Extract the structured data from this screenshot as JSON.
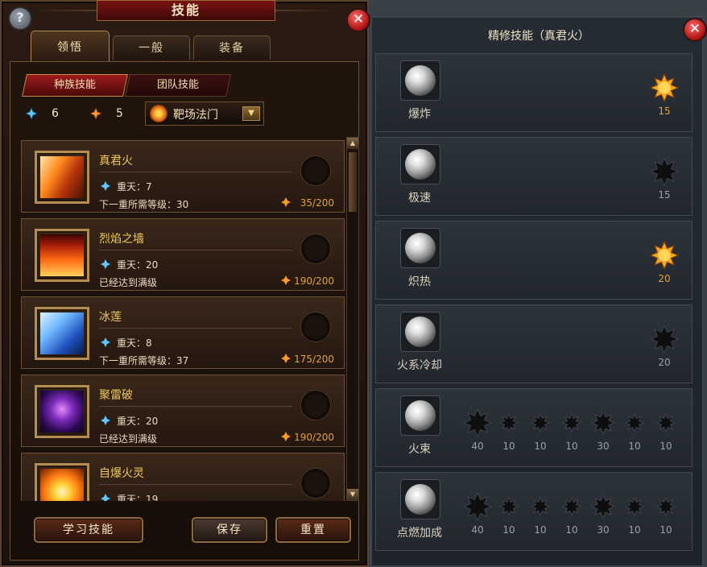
{
  "left_window": {
    "title": "技能",
    "help_label": "?",
    "close_label": "✕",
    "tabs": [
      "领悟",
      "一般",
      "装备"
    ],
    "subtabs": [
      "种族技能",
      "团队技能"
    ],
    "resources": {
      "blue_value": "6",
      "orange_value": "5",
      "blue_icon": "blue-crystal-icon",
      "orange_icon": "orange-crystal-icon"
    },
    "school_select": {
      "value": "靶场法门",
      "icon": "flame-swirl-icon",
      "arrow": "▼"
    },
    "skills": [
      {
        "name": "真君火",
        "tier": "重天：7",
        "note": "下一重所需等级：30",
        "cost": "35/200"
      },
      {
        "name": "烈焰之墙",
        "tier": "重天：20",
        "note": "已经达到满级",
        "cost": "190/200"
      },
      {
        "name": "冰莲",
        "tier": "重天：8",
        "note": "下一重所需等级：37",
        "cost": "175/200"
      },
      {
        "name": "聚雷破",
        "tier": "重天：20",
        "note": "已经达到满级",
        "cost": "190/200"
      },
      {
        "name": "自爆火灵",
        "tier": "重天：19",
        "note": "",
        "cost": ""
      }
    ],
    "scroll": {
      "up": "▲",
      "down": "▼"
    },
    "buttons": {
      "learn": "学习技能",
      "save": "保存",
      "reset": "重置"
    }
  },
  "right_panel": {
    "title": "精修技能（真君火）",
    "close_label": "✕",
    "rows": [
      {
        "label": "爆炸",
        "nodes": [
          {
            "value": "15",
            "active": true
          }
        ]
      },
      {
        "label": "极速",
        "nodes": [
          {
            "value": "15",
            "active": false
          }
        ]
      },
      {
        "label": "炽热",
        "nodes": [
          {
            "value": "20",
            "active": true
          }
        ]
      },
      {
        "label": "火系冷却",
        "nodes": [
          {
            "value": "20",
            "active": false
          }
        ]
      },
      {
        "label": "火束",
        "nodes": [
          {
            "value": "40",
            "size": "large"
          },
          {
            "value": "10",
            "size": "small"
          },
          {
            "value": "10",
            "size": "small"
          },
          {
            "value": "10",
            "size": "small"
          },
          {
            "value": "30",
            "size": "medium"
          },
          {
            "value": "10",
            "size": "small"
          },
          {
            "value": "10",
            "size": "small"
          }
        ]
      },
      {
        "label": "点燃加成",
        "nodes": [
          {
            "value": "40",
            "size": "large"
          },
          {
            "value": "10",
            "size": "small"
          },
          {
            "value": "10",
            "size": "small"
          },
          {
            "value": "10",
            "size": "small"
          },
          {
            "value": "30",
            "size": "medium"
          },
          {
            "value": "10",
            "size": "small"
          },
          {
            "value": "10",
            "size": "small"
          }
        ]
      }
    ]
  },
  "colors": {
    "active_node": "#f6a623",
    "inactive_node": "#0e0e0e",
    "gold_text": "#f0c85c",
    "cost_text": "#e0a23a"
  }
}
